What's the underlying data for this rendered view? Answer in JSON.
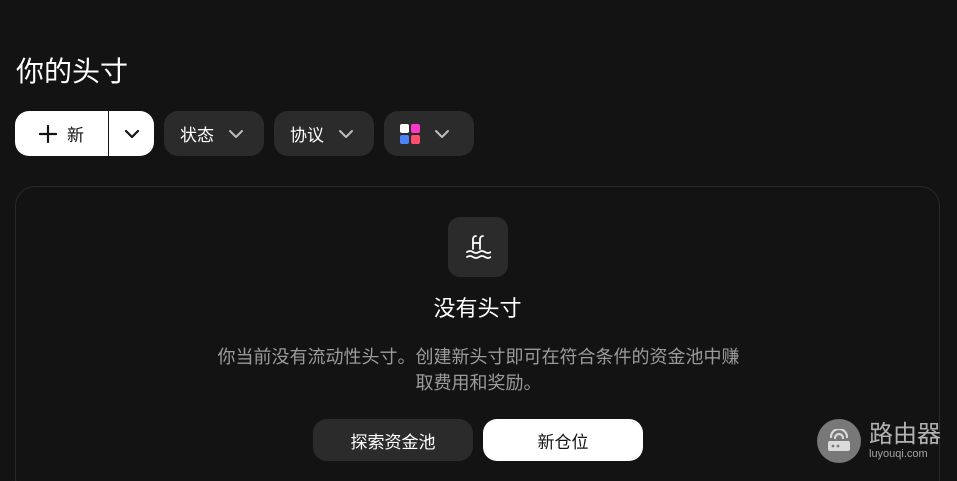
{
  "page": {
    "title": "你的头寸"
  },
  "toolbar": {
    "new_label": "新",
    "status_label": "状态",
    "protocol_label": "协议",
    "network_icons": [
      "#ffffff",
      "#ff37c7",
      "#4c82fb",
      "#ff4d6d"
    ]
  },
  "empty_state": {
    "title": "没有头寸",
    "description": "你当前没有流动性头寸。创建新头寸即可在符合条件的资金池中赚取费用和奖励。",
    "explore_label": "探索资金池",
    "new_position_label": "新仓位"
  },
  "watermark": {
    "name": "路由器",
    "url": "luyouqi.com"
  }
}
